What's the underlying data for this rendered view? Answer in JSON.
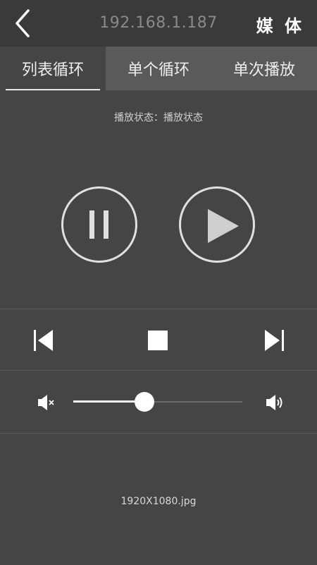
{
  "header": {
    "ip": "192.168.1.187",
    "media_label": "媒 体"
  },
  "tabs": [
    {
      "label": "列表循环",
      "active": true
    },
    {
      "label": "单个循环",
      "active": false
    },
    {
      "label": "单次播放",
      "active": false
    }
  ],
  "status_text": "播放状态：播放状态",
  "volume": {
    "level": 0.42
  },
  "file_name": "1920X1080.jpg",
  "icons": {
    "back": "chevron-left-icon",
    "pause": "pause-icon",
    "play": "play-icon",
    "prev": "skip-previous-icon",
    "stop": "stop-icon",
    "next": "skip-next-icon",
    "mute": "volume-mute-icon",
    "volume_up": "volume-up-icon"
  },
  "colors": {
    "background": "#454545",
    "topbar": "#3a3a3a",
    "tabs_inactive": "#5a5a5a",
    "accent": "#ffffff"
  }
}
